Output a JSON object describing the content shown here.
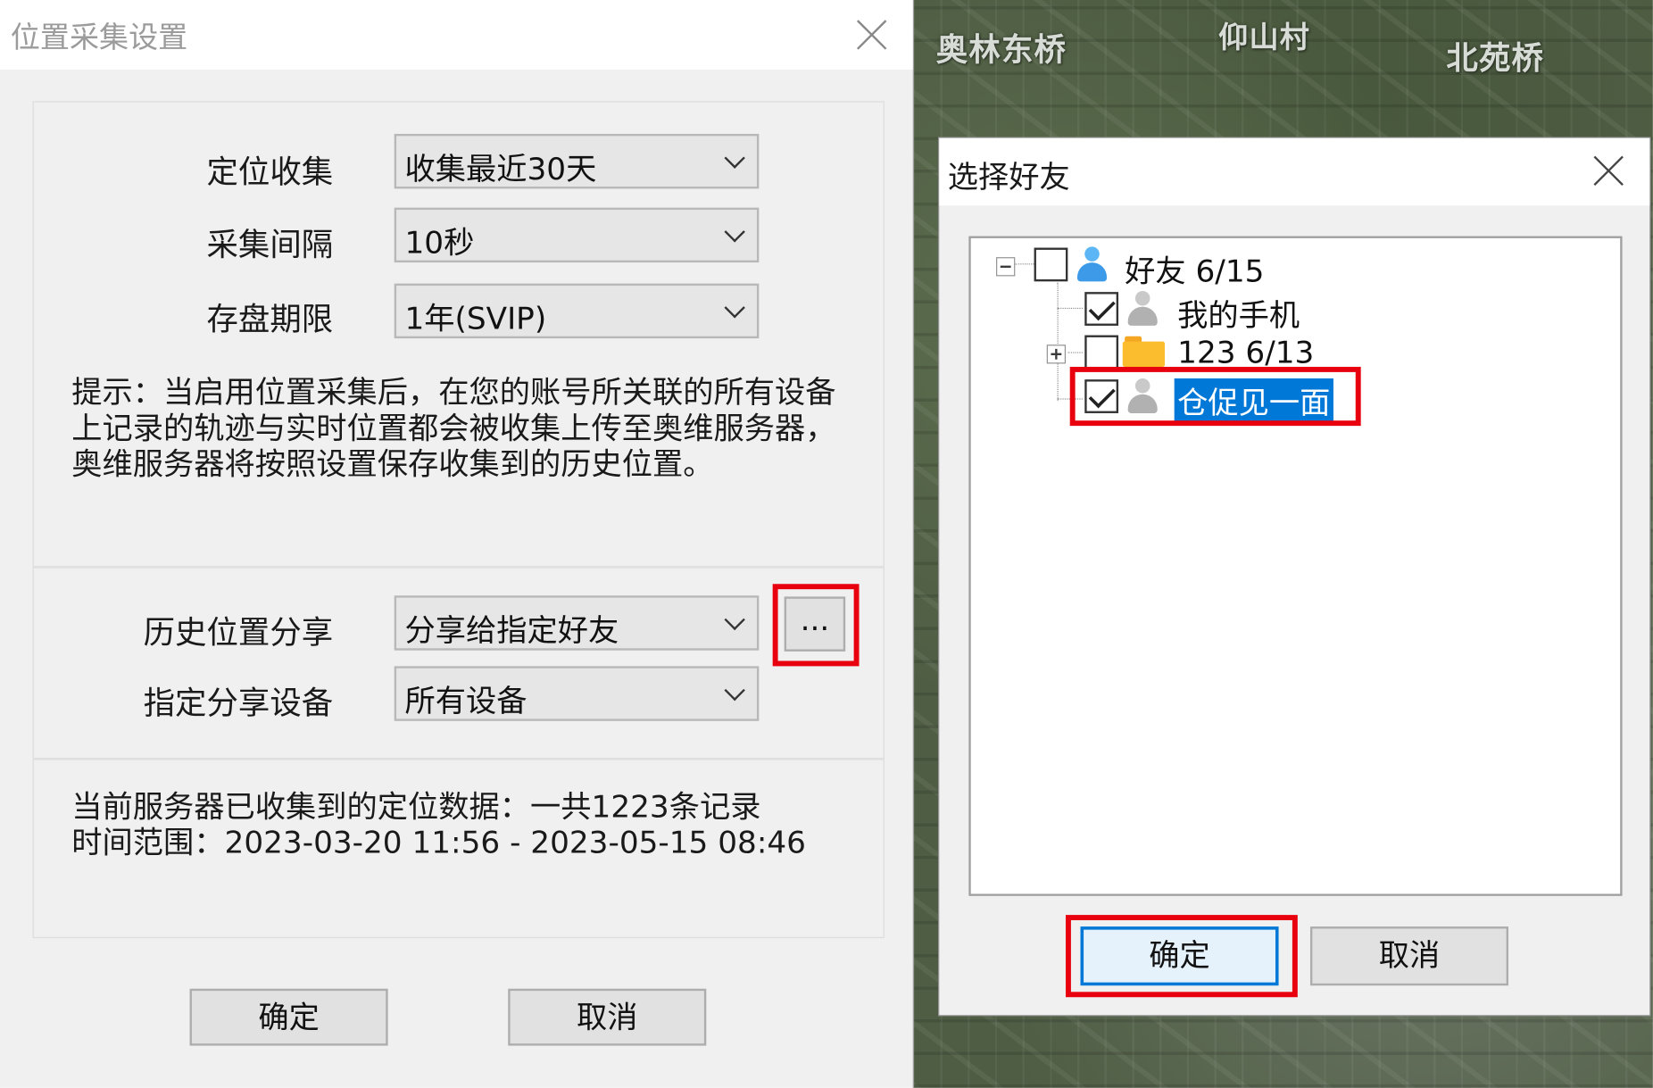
{
  "left_dialog": {
    "title": "位置采集设置",
    "fields": [
      {
        "label": "定位收集",
        "value": "收集最近30天"
      },
      {
        "label": "采集间隔",
        "value": "10秒"
      },
      {
        "label": "存盘期限",
        "value": "1年(SVIP)"
      }
    ],
    "hint_text": "提示：当启用位置采集后，在您的账号所关联的所有设备上记录的轨迹与实时位置都会被收集上传至奥维服务器，奥维服务器将按照设置保存收集到的历史位置。",
    "share_fields": [
      {
        "label": "历史位置分享",
        "value": "分享给指定好友"
      },
      {
        "label": "指定分享设备",
        "value": "所有设备"
      }
    ],
    "more_button_label": "...",
    "info_line1": "当前服务器已收集到的定位数据：一共1223条记录",
    "info_line2": "时间范围：2023-03-20 11:56 - 2023-05-15 08:46",
    "ok_label": "确定",
    "cancel_label": "取消"
  },
  "map": {
    "labels": [
      "奥林东桥",
      "仰山村",
      "北苑桥"
    ]
  },
  "right_dialog": {
    "title": "选择好友",
    "tree": [
      {
        "label": "好友 6/15",
        "checked": false,
        "icon": "person-blue-icon"
      },
      {
        "label": "我的手机",
        "checked": true,
        "icon": "person-gray-icon"
      },
      {
        "label": "123 6/13",
        "checked": false,
        "icon": "folder-icon"
      },
      {
        "label": "仓促见一面",
        "checked": true,
        "icon": "person-gray-icon",
        "selected": true
      }
    ],
    "ok_label": "确定",
    "cancel_label": "取消"
  },
  "colors": {
    "highlight_red": "#e8000e",
    "selection_blue": "#0078d7"
  }
}
